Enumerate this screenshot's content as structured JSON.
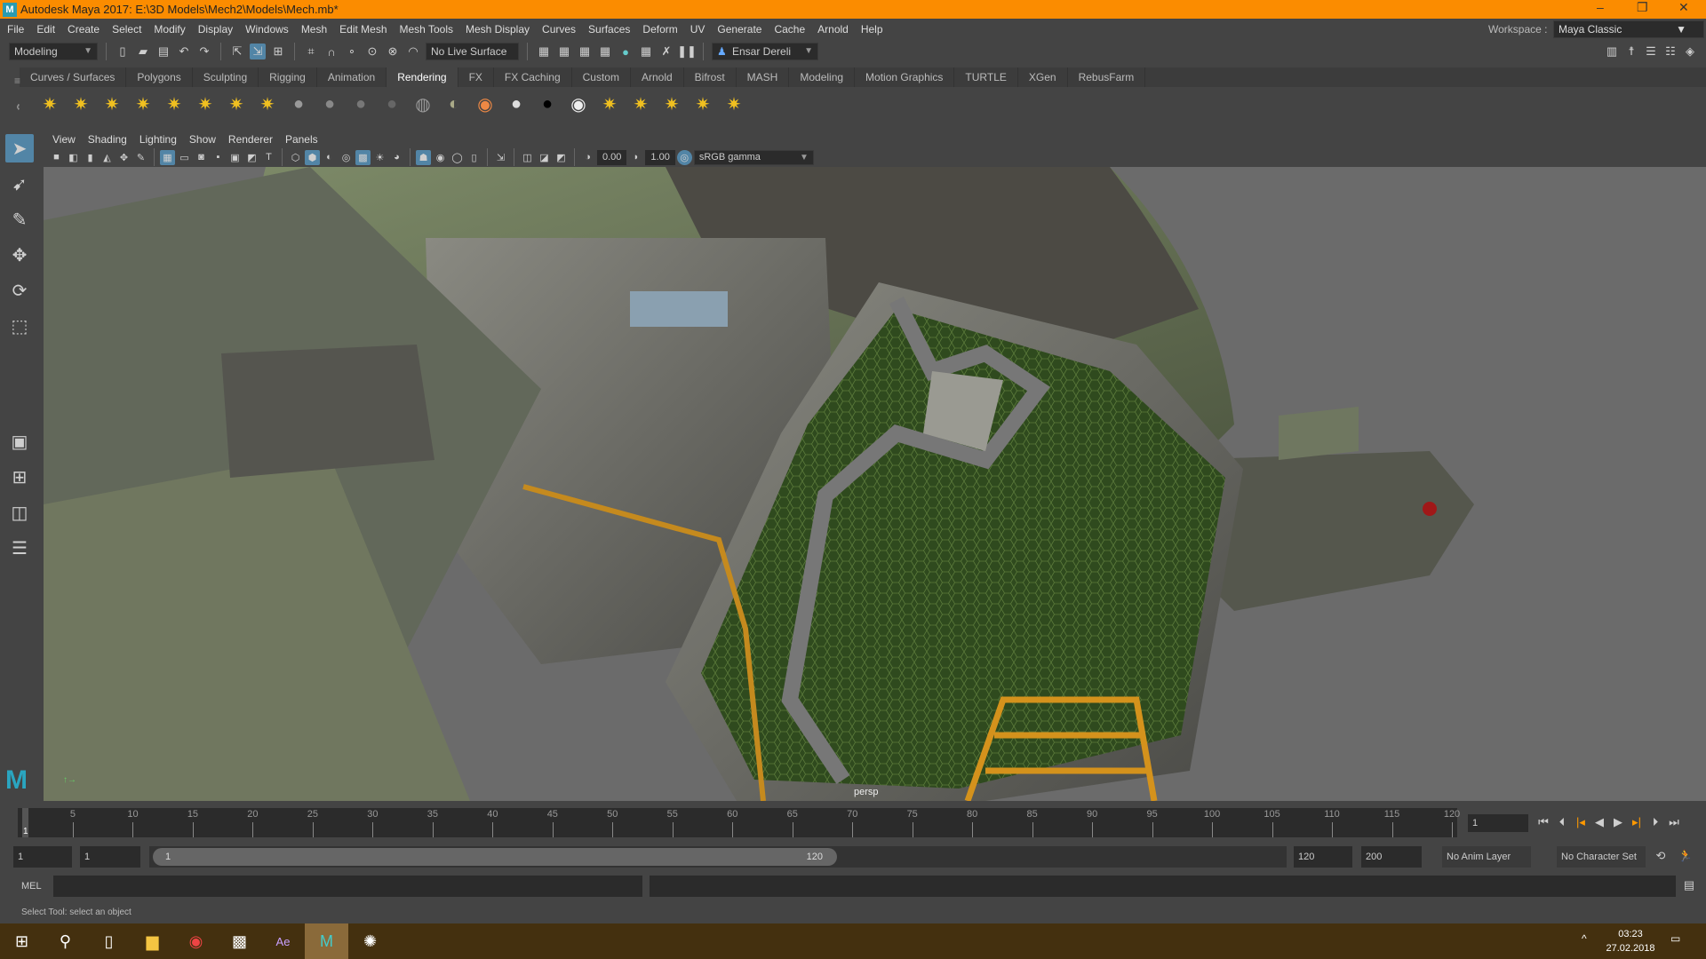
{
  "title": "Autodesk Maya 2017: E:\\3D Models\\Mech2\\Models\\Mech.mb*",
  "menus": [
    "File",
    "Edit",
    "Create",
    "Select",
    "Modify",
    "Display",
    "Windows",
    "Mesh",
    "Edit Mesh",
    "Mesh Tools",
    "Mesh Display",
    "Curves",
    "Surfaces",
    "Deform",
    "UV",
    "Generate",
    "Cache",
    "Arnold",
    "Help"
  ],
  "workspace": {
    "label": "Workspace :",
    "value": "Maya Classic"
  },
  "statusline": {
    "mode": "Modeling",
    "live_surface": "No Live Surface",
    "user": "Ensar Dereli"
  },
  "shelf_tabs": [
    "Curves / Surfaces",
    "Polygons",
    "Sculpting",
    "Rigging",
    "Animation",
    "Rendering",
    "FX",
    "FX Caching",
    "Custom",
    "Arnold",
    "Bifrost",
    "MASH",
    "Modeling",
    "Motion Graphics",
    "TURTLE",
    "XGen",
    "RebusFarm"
  ],
  "active_shelf": "Rendering",
  "shelf_icons": [
    "ambient-light-icon",
    "directional-light-icon",
    "point-light-icon",
    "spot-light-icon",
    "area-light-icon",
    "volume-light-icon",
    "camera-icon",
    "camera-aim-icon",
    "blinn-icon",
    "lambert-icon",
    "phong-icon",
    "anisotropic-icon",
    "surface-shader-icon",
    "layered-shader-icon",
    "ramp-shader-icon",
    "white-sphere-icon",
    "black-sphere-icon",
    "white-outline-sphere-icon",
    "hypershade-icon",
    "render-icon",
    "ipr-icon",
    "render-settings-icon",
    "render-view-icon"
  ],
  "viewport": {
    "menus": [
      "View",
      "Shading",
      "Lighting",
      "Show",
      "Renderer",
      "Panels"
    ],
    "exposure": "0.00",
    "gamma": "1.00",
    "color_space": "sRGB gamma",
    "camera": "persp"
  },
  "timeline": {
    "start": 1,
    "end": 120,
    "current": 1,
    "labels": [
      5,
      10,
      15,
      20,
      25,
      30,
      35,
      40,
      45,
      50,
      55,
      60,
      65,
      70,
      75,
      80,
      85,
      90,
      95,
      100,
      105,
      110,
      115,
      120
    ],
    "current_frame_field": "1"
  },
  "range": {
    "start_field": "1",
    "start2_field": "1",
    "slider_start": "1",
    "slider_end": "120",
    "end_field": "120",
    "end2_field": "200",
    "anim_layer": "No Anim Layer",
    "character_set": "No Character Set"
  },
  "mel": {
    "label": "MEL"
  },
  "help_line": "Select Tool: select an object",
  "clock": {
    "time": "03:23",
    "date": "27.02.2018"
  }
}
